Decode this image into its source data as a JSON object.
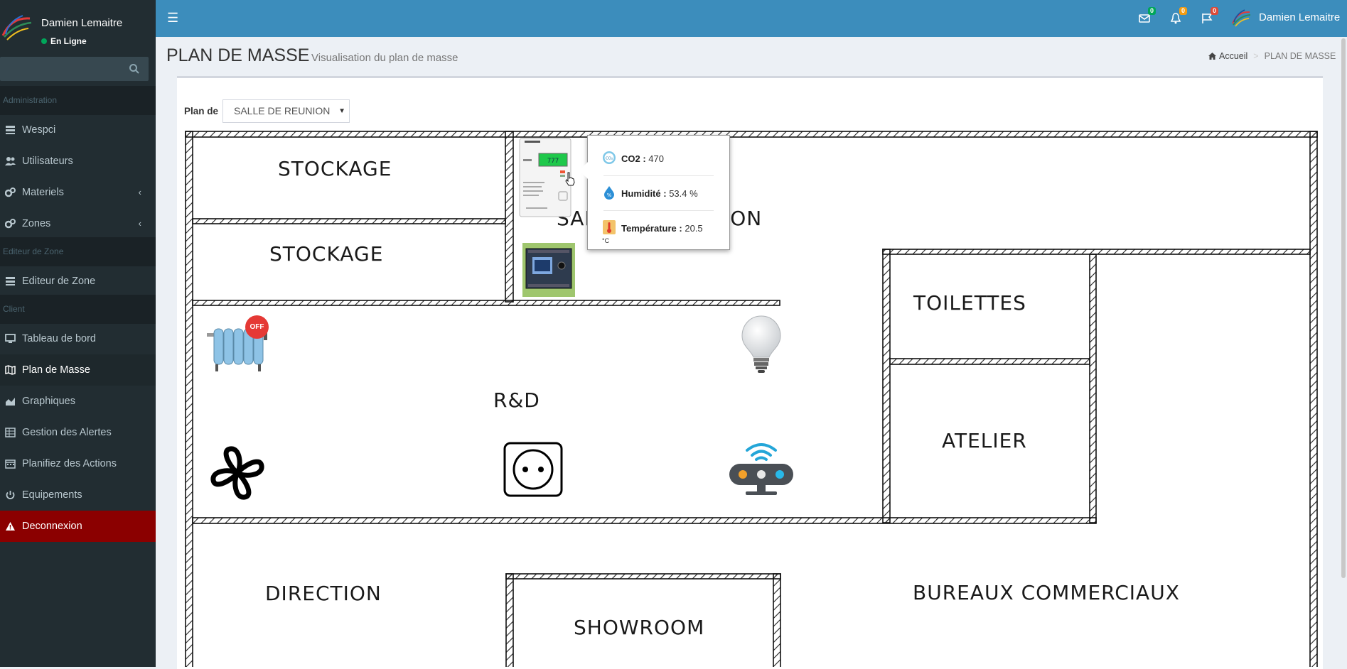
{
  "user": {
    "name": "Damien Lemaitre",
    "status": "En Ligne"
  },
  "search": {
    "placeholder": ""
  },
  "sidebar": {
    "sections": [
      "Administration",
      "Editeur de Zone",
      "Client"
    ],
    "items": [
      {
        "label": "Wespci",
        "icon": "server-icon"
      },
      {
        "label": "Utilisateurs",
        "icon": "users-icon"
      },
      {
        "label": "Materiels",
        "icon": "cogs-icon",
        "chevron": "‹"
      },
      {
        "label": "Zones",
        "icon": "cogs-icon",
        "chevron": "‹"
      },
      {
        "label": "Editeur de Zone",
        "icon": "server-icon"
      },
      {
        "label": "Tableau de bord",
        "icon": "monitor-icon"
      },
      {
        "label": "Plan de Masse",
        "icon": "map-icon"
      },
      {
        "label": "Graphiques",
        "icon": "area-chart-icon"
      },
      {
        "label": "Gestion des Alertes",
        "icon": "table-icon"
      },
      {
        "label": "Planifiez des Actions",
        "icon": "calendar-icon"
      },
      {
        "label": "Equipements",
        "icon": "power-icon"
      },
      {
        "label": "Deconnexion",
        "icon": "warning-icon"
      }
    ]
  },
  "topbar": {
    "messages_count": "0",
    "notifications_count": "0",
    "flags_count": "0",
    "user_name": "Damien Lemaitre"
  },
  "page": {
    "title": "PLAN DE MASSE",
    "subtitle": "Visualisation du plan de masse",
    "breadcrumb": {
      "home": "Accueil",
      "separator": ">",
      "current": "PLAN DE MASSE"
    }
  },
  "plan": {
    "label": "Plan de",
    "selected": "SALLE DE REUNION"
  },
  "rooms": {
    "stockage_1": "STOCKAGE",
    "stockage_2": "STOCKAGE",
    "salle_reunion": "SALLE DE REUNION",
    "toilettes": "TOILETTES",
    "atelier": "ATELIER",
    "rnd": "R&D",
    "direction": "DIRECTION",
    "showroom": "SHOWROOM",
    "bureaux": "BUREAUX COMMERCIAUX"
  },
  "devices": {
    "radiator_state": "OFF"
  },
  "tooltip": {
    "co2_label": "CO2 :",
    "co2_value": "470",
    "humidity_label": "Humidité :",
    "humidity_value": "53.4 %",
    "temperature_label": "Température :",
    "temperature_value": "20.5",
    "temperature_unit": "°C"
  },
  "colors": {
    "sidebar_bg": "#222d32",
    "topbar_bg": "#3c8dbc",
    "danger_bg": "#8b0000",
    "badge_green": "#00a65a",
    "badge_orange": "#f39c12",
    "badge_red": "#dd4b39"
  }
}
